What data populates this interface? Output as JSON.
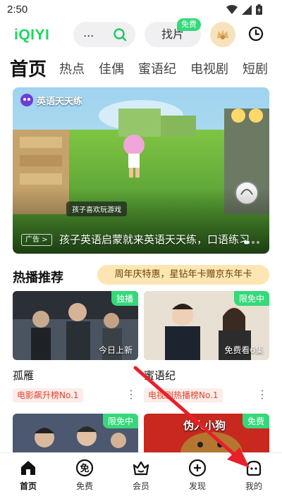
{
  "status_bar": {
    "time": "2:50"
  },
  "header": {
    "logo": "iQIYI",
    "search_placeholder": "...",
    "find_label": "找片",
    "find_badge": "免费"
  },
  "tabs": [
    {
      "label": "首页",
      "active": true
    },
    {
      "label": "热点"
    },
    {
      "label": "佳偶"
    },
    {
      "label": "蜜语纪"
    },
    {
      "label": "电视剧"
    },
    {
      "label": "短剧"
    }
  ],
  "banner": {
    "brand": "英语天天练",
    "caption_tag": "孩子喜欢玩游戏",
    "ad_label": "广告 >",
    "title": "孩子英语启蒙就来英语天天练，口语练习"
  },
  "section": {
    "title": "热播推荐",
    "promo": "周年庆特惠，星钻年卡赠京东年卡"
  },
  "cards": [
    {
      "badge": "独播",
      "overlay": "今日上新",
      "title": "孤雁",
      "rank": "电影飙升榜No.1"
    },
    {
      "badge": "限免中",
      "overlay": "免费看6集",
      "title": "蜜语纪",
      "rank": "电视剧热播榜No.1"
    },
    {
      "badge": "限免中"
    },
    {
      "badge": "免费",
      "poster_text": "伪人小狗"
    }
  ],
  "bottom_nav": [
    {
      "label": "首页",
      "icon": "home-icon",
      "active": true
    },
    {
      "label": "免费",
      "icon": "free-icon"
    },
    {
      "label": "会员",
      "icon": "vip-crown-icon"
    },
    {
      "label": "发现",
      "icon": "discover-plus-icon"
    },
    {
      "label": "我的",
      "icon": "profile-icon"
    }
  ],
  "colors": {
    "brand_green": "#1ed760",
    "badge_green": "#35d97a",
    "promo_bg": "#fde5b4",
    "rank_red": "#e0452f",
    "arrow_red": "#e8202a"
  }
}
